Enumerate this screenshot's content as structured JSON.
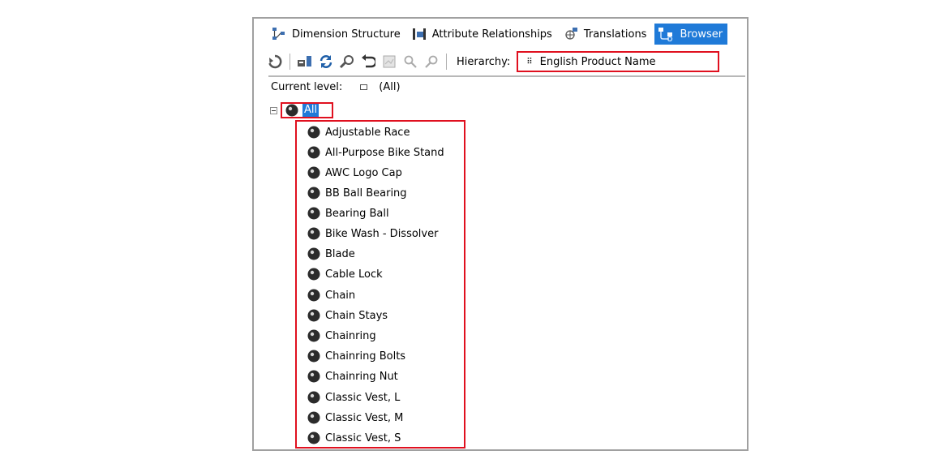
{
  "tabs": [
    {
      "label": "Dimension Structure",
      "icon": "dimension-structure-icon",
      "active": false
    },
    {
      "label": "Attribute Relationships",
      "icon": "attribute-relationships-icon",
      "active": false
    },
    {
      "label": "Translations",
      "icon": "translations-icon",
      "active": false
    },
    {
      "label": "Browser",
      "icon": "browser-icon",
      "active": true
    }
  ],
  "toolbar": {
    "hierarchy_label": "Hierarchy:",
    "hierarchy_value": "English Product Name"
  },
  "current_level": {
    "label": "Current level:",
    "value": "(All)"
  },
  "tree": {
    "root_label": "All",
    "members": [
      "Adjustable Race",
      "All-Purpose Bike Stand",
      "AWC Logo Cap",
      "BB Ball Bearing",
      "Bearing Ball",
      "Bike Wash - Dissolver",
      "Blade",
      "Cable Lock",
      "Chain",
      "Chain Stays",
      "Chainring",
      "Chainring Bolts",
      "Chainring Nut",
      "Classic Vest, L",
      "Classic Vest, M",
      "Classic Vest, S"
    ]
  },
  "colors": {
    "accent": "#1f7ad8",
    "highlight_border": "#e0101f"
  }
}
